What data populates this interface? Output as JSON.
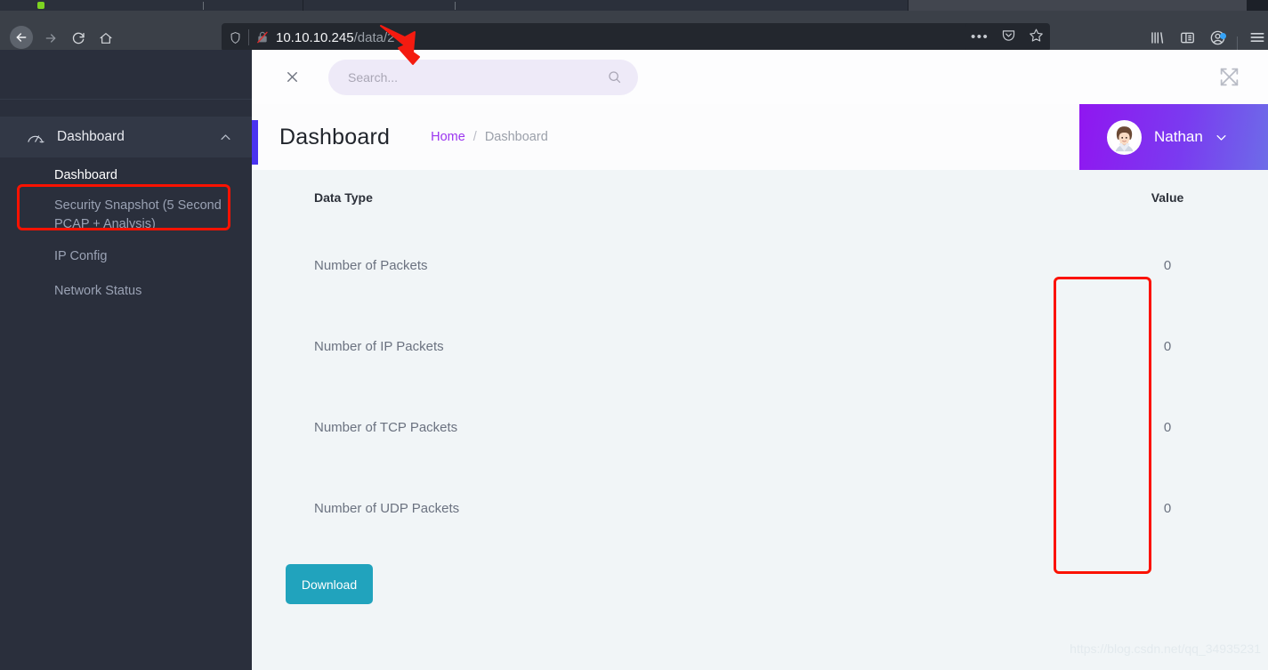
{
  "browser": {
    "tabs": [
      {
        "label": "",
        "selected": false
      },
      {
        "label": "",
        "selected": false
      },
      {
        "label": "",
        "selected": true
      }
    ],
    "nav": {
      "back_label": "Back",
      "forward_label": "Forward",
      "reload_label": "Reload",
      "home_label": "Home"
    },
    "urlbar": {
      "host": "10.10.10.245",
      "path": "/data/2",
      "shield_icon": "shield-icon",
      "insecure_icon": "lock-broken-icon",
      "page_actions_icon": "ellipsis-icon",
      "pocket_icon": "pocket-icon",
      "bookmark_icon": "star-icon"
    },
    "toolbar": {
      "library_icon": "library-icon",
      "sidebar_icon": "sidebar-icon",
      "account_icon": "account-icon",
      "menu_icon": "hamburger-menu-icon"
    }
  },
  "sidebar": {
    "section": {
      "label": "Dashboard",
      "icon": "gauge-icon",
      "chevron": "chevron-up-icon",
      "expanded": true
    },
    "items": [
      {
        "label": "Dashboard",
        "active": true
      },
      {
        "label": "Security Snapshot (5 Second PCAP + Analysis)",
        "active": false,
        "highlighted": true
      },
      {
        "label": "IP Config",
        "active": false
      },
      {
        "label": "Network Status",
        "active": false
      }
    ]
  },
  "topbar": {
    "close_icon": "close-icon",
    "search": {
      "placeholder": "Search...",
      "value": "",
      "icon": "search-icon"
    },
    "fullscreen_icon": "expand-icon"
  },
  "header": {
    "title": "Dashboard",
    "breadcrumb": {
      "home": "Home",
      "separator": "/",
      "current": "Dashboard"
    },
    "user": {
      "name": "Nathan",
      "avatar": "avatar",
      "chevron": "chevron-down-icon"
    },
    "accent_color": "#4a33f0"
  },
  "table": {
    "columns": {
      "type": "Data Type",
      "value": "Value"
    },
    "rows": [
      {
        "type": "Number of Packets",
        "value": "0"
      },
      {
        "type": "Number of IP Packets",
        "value": "0"
      },
      {
        "type": "Number of TCP Packets",
        "value": "0"
      },
      {
        "type": "Number of UDP Packets",
        "value": "0"
      }
    ]
  },
  "actions": {
    "download_label": "Download",
    "download_color": "#21a3bd"
  },
  "watermark": "https://blog.csdn.net/qq_34935231",
  "annotations": {
    "color": "#fb1200",
    "boxes": [
      {
        "name": "sidebar-item-security-snapshot"
      },
      {
        "name": "value-column"
      }
    ],
    "arrow": {
      "name": "url-arrow",
      "points_to": "/data/2"
    }
  }
}
